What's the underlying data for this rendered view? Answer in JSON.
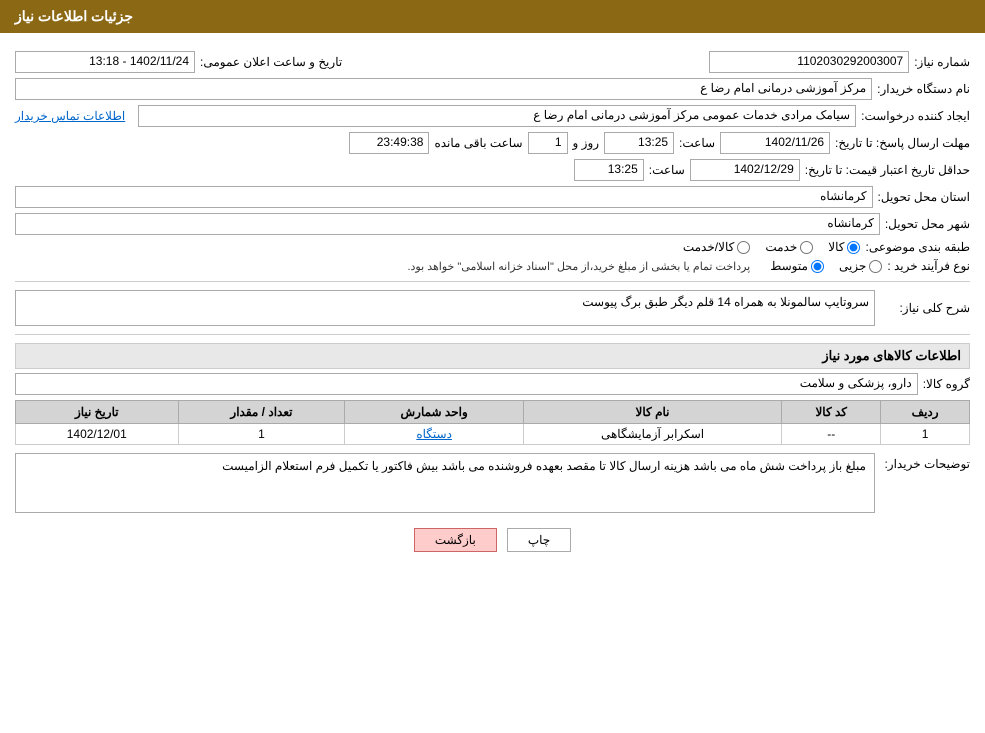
{
  "header": {
    "title": "جزئیات اطلاعات نیاز"
  },
  "fields": {
    "shomareNiaz_label": "شماره نیاز:",
    "shomareNiaz_value": "1102030292003007",
    "namDastgah_label": "نام دستگاه خریدار:",
    "namDastgah_value": "مرکز آموزشی  درمانی امام رضا  ع",
    "tarikh_label": "تاریخ و ساعت اعلان عمومی:",
    "tarikh_value": "1402/11/24 - 13:18",
    "ijadKonande_label": "ایجاد کننده درخواست:",
    "ijadKonande_value": "سیامک مرادی خدمات عمومی مرکز آموزشی  درمانی امام رضا  ع",
    "etelaatTamas_label": "اطلاعات تماس خریدار",
    "mohlat_label": "مهلت ارسال پاسخ: تا تاریخ:",
    "mohlat_date": "1402/11/26",
    "mohlat_saat_label": "ساعت:",
    "mohlat_saat": "13:25",
    "mohlat_roz_label": "روز و",
    "mohlat_roz": "1",
    "mohlat_mande_label": "ساعت باقی مانده",
    "mohlat_mande": "23:49:38",
    "hadaq_label": "حداقل تاریخ اعتبار قیمت: تا تاریخ:",
    "hadaq_date": "1402/12/29",
    "hadaq_saat_label": "ساعت:",
    "hadaq_saat": "13:25",
    "ostan_label": "استان محل تحویل:",
    "ostan_value": "کرمانشاه",
    "shahr_label": "شهر محل تحویل:",
    "shahr_value": "کرمانشاه",
    "tabaghe_label": "طبقه بندی موضوعی:",
    "tabaghe_kala": "کالا",
    "tabaghe_khedmat": "خدمت",
    "tabaghe_kala_khedmat": "کالا/خدمت",
    "noeFarayand_label": "نوع فرآیند خرید :",
    "noeFarayand_jozi": "جزیی",
    "noeFarayand_motavaset": "متوسط",
    "noeFarayand_note": "پرداخت تمام یا بخشی از مبلغ خرید،از محل \"اسناد خزانه اسلامی\" خواهد بود.",
    "sharh_label": "شرح کلی نیاز:",
    "sharh_value": "سروتایپ سالمونلا به همراه 14 قلم دیگر طبق برگ پیوست",
    "kalaInfo_title": "اطلاعات کالاهای مورد نیاز",
    "groupKala_label": "گروه کالا:",
    "groupKala_value": "دارو، پزشکی و سلامت",
    "table_headers": [
      "ردیف",
      "کد کالا",
      "نام کالا",
      "واحد شمارش",
      "تعداد / مقدار",
      "تاریخ نیاز"
    ],
    "table_rows": [
      {
        "radif": "1",
        "kod_kala": "--",
        "name_kala": "اسکرابر آزمایشگاهی",
        "vahed": "دستگاه",
        "tedad": "1",
        "tarikh": "1402/12/01"
      }
    ],
    "toshihat_label": "توضیحات خریدار:",
    "toshihat_value": "مبلغ باز پرداخت شش ماه می باشد هزینه ارسال کالا تا مقصد بعهده فروشنده می باشد بیش فاکتور یا تکمیل فرم استعلام الزامیست",
    "btn_chap": "چاپ",
    "btn_bazgasht": "بازگشت"
  }
}
